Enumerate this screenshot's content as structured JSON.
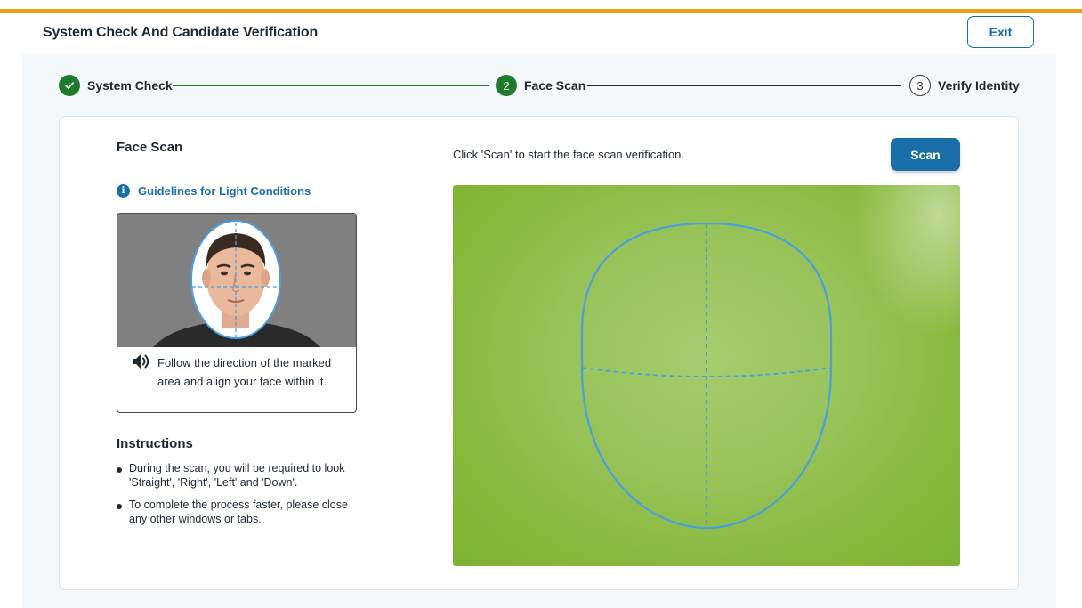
{
  "header": {
    "title": "System Check And Candidate Verification",
    "exit_label": "Exit"
  },
  "stepper": {
    "steps": [
      {
        "number": "✓",
        "label": "System Check",
        "state": "done"
      },
      {
        "number": "2",
        "label": "Face Scan",
        "state": "active"
      },
      {
        "number": "3",
        "label": "Verify Identity",
        "state": "pending"
      }
    ]
  },
  "left_panel": {
    "title": "Face Scan",
    "guidelines_link": "Guidelines for Light Conditions",
    "guide_caption": "Follow the direction of the marked area and align your face within it.",
    "instructions_title": "Instructions",
    "instructions": [
      "During the scan, you will be required to look 'Straight', 'Right', 'Left' and 'Down'.",
      "To complete the process faster, please close any other windows or tabs."
    ]
  },
  "scan_panel": {
    "hint": "Click 'Scan' to start the face scan verification.",
    "scan_label": "Scan"
  },
  "colors": {
    "accent_bar": "#e6a20c",
    "primary": "#1b6fa8",
    "success": "#1e7b2c",
    "guide_outline": "#4a9fe0",
    "camera_background": "#8fbd4a"
  },
  "icons": {
    "step_done": "check-icon",
    "info": "info-icon",
    "audio": "speaker-icon"
  }
}
